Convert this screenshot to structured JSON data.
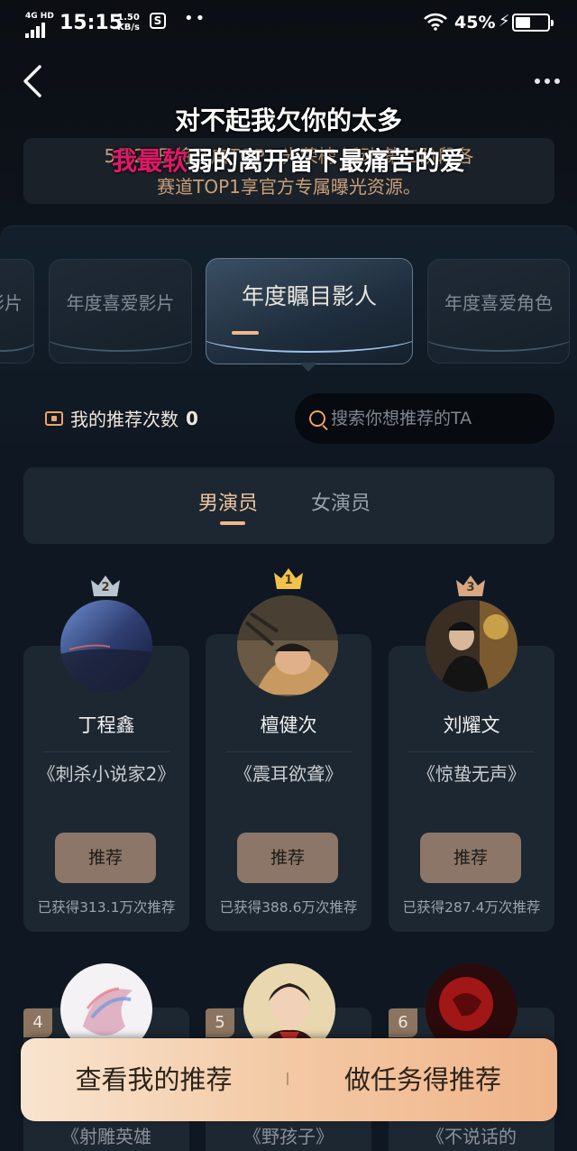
{
  "status_bar": {
    "network": "4G HD",
    "time": "15:15",
    "speed_value": "1.50",
    "speed_unit": "KB/s",
    "app_badge": "S",
    "battery_percent": "45%"
  },
  "notice": {
    "text_line1": "5月21日将开启TOP1 光荣榜 活动 第二阶段各",
    "text_line2": "赛道TOP1享官方专属曝光资源。"
  },
  "lyrics": {
    "line1": "对不起我欠你的太多",
    "line2_highlight": "我最软",
    "line2_rest": "弱的离开留下最痛苦的爱"
  },
  "award_tabs": [
    {
      "label": "影片"
    },
    {
      "label": "年度喜爱影片"
    },
    {
      "label": "年度瞩目影人"
    },
    {
      "label": "年度喜爱角色"
    }
  ],
  "recommend": {
    "label": "我的推荐次数",
    "count": "0"
  },
  "search": {
    "placeholder": "搜索你想推荐的TA"
  },
  "gender_tabs": [
    {
      "label": "男演员"
    },
    {
      "label": "女演员"
    }
  ],
  "candidates": [
    {
      "rank": "2",
      "name": "丁程鑫",
      "work": "《刺杀小说家2》",
      "button": "推荐",
      "count": "已获得313.1万次推荐",
      "crown_color": "#b9c6d2"
    },
    {
      "rank": "1",
      "name": "檀健次",
      "work": "《震耳欲聋》",
      "button": "推荐",
      "count": "已获得388.6万次推荐",
      "crown_color": "#f2c24a"
    },
    {
      "rank": "3",
      "name": "刘耀文",
      "work": "《惊蛰无声》",
      "button": "推荐",
      "count": "已获得287.4万次推荐",
      "crown_color": "#d8a783"
    }
  ],
  "candidates_row2": [
    {
      "rank": "4",
      "work": "《射雕英雄"
    },
    {
      "rank": "5",
      "work": "《野孩子》"
    },
    {
      "rank": "6",
      "work": "《不说话的"
    }
  ],
  "action_bar": {
    "left_label": "查看我的推荐",
    "right_label": "做任务得推荐"
  }
}
